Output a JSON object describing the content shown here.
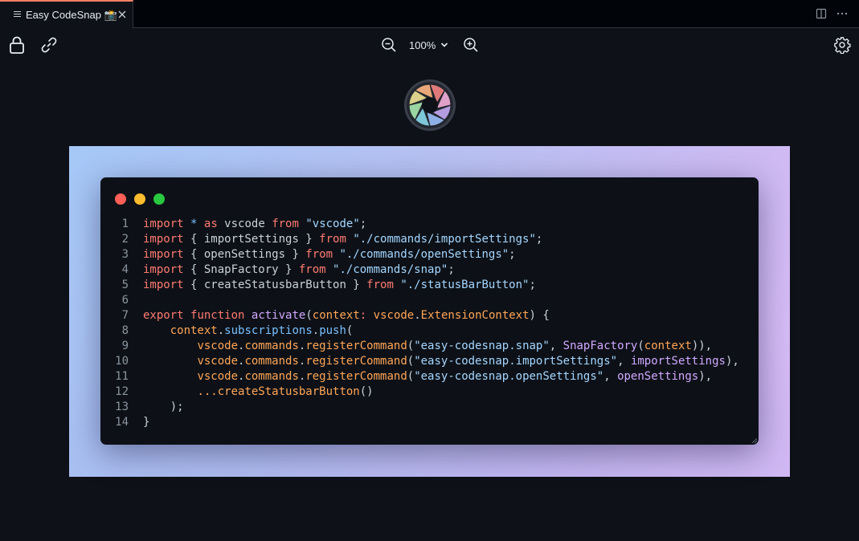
{
  "tab": {
    "title": "Easy CodeSnap 📸"
  },
  "toolbar": {
    "zoom": "100%"
  },
  "window_dots": [
    "#ff5f57",
    "#febc2e",
    "#28c840"
  ],
  "colors": {
    "keyword": "#ff7b72",
    "string": "#a5d6ff",
    "func": "#d2a8ff",
    "prop": "#79c0ff",
    "param": "#ffa657",
    "plain": "#c9d1d9",
    "line_number": "#8b949e"
  },
  "code": {
    "line_numbers": [
      "1",
      "2",
      "3",
      "4",
      "5",
      "6",
      "7",
      "8",
      "9",
      "10",
      "11",
      "12",
      "13",
      "14"
    ],
    "lines": [
      [
        [
          "k",
          "import"
        ],
        [
          "p",
          " "
        ],
        [
          "o",
          "*"
        ],
        [
          "p",
          " "
        ],
        [
          "k",
          "as"
        ],
        [
          "p",
          " vscode "
        ],
        [
          "k",
          "from"
        ],
        [
          "p",
          " "
        ],
        [
          "s",
          "\"vscode\""
        ],
        [
          "p",
          ";"
        ]
      ],
      [
        [
          "k",
          "import"
        ],
        [
          "p",
          " { importSettings } "
        ],
        [
          "k",
          "from"
        ],
        [
          "p",
          " "
        ],
        [
          "s",
          "\"./commands/importSettings\""
        ],
        [
          "p",
          ";"
        ]
      ],
      [
        [
          "k",
          "import"
        ],
        [
          "p",
          " { openSettings } "
        ],
        [
          "k",
          "from"
        ],
        [
          "p",
          " "
        ],
        [
          "s",
          "\"./commands/openSettings\""
        ],
        [
          "p",
          ";"
        ]
      ],
      [
        [
          "k",
          "import"
        ],
        [
          "p",
          " { SnapFactory } "
        ],
        [
          "k",
          "from"
        ],
        [
          "p",
          " "
        ],
        [
          "s",
          "\"./commands/snap\""
        ],
        [
          "p",
          ";"
        ]
      ],
      [
        [
          "k",
          "import"
        ],
        [
          "p",
          " { createStatusbarButton } "
        ],
        [
          "k",
          "from"
        ],
        [
          "p",
          " "
        ],
        [
          "s",
          "\"./statusBarButton\""
        ],
        [
          "p",
          ";"
        ]
      ],
      [],
      [
        [
          "k",
          "export"
        ],
        [
          "p",
          " "
        ],
        [
          "k",
          "function"
        ],
        [
          "p",
          " "
        ],
        [
          "f",
          "activate"
        ],
        [
          "p",
          "("
        ],
        [
          "a",
          "context"
        ],
        [
          "k",
          ":"
        ],
        [
          "p",
          " "
        ],
        [
          "a",
          "vscode"
        ],
        [
          "p",
          "."
        ],
        [
          "a",
          "ExtensionContext"
        ],
        [
          "p",
          ") {"
        ]
      ],
      [
        [
          "p",
          "    "
        ],
        [
          "a",
          "context"
        ],
        [
          "p",
          "."
        ],
        [
          "c",
          "subscriptions"
        ],
        [
          "p",
          "."
        ],
        [
          "c",
          "push"
        ],
        [
          "p",
          "("
        ]
      ],
      [
        [
          "p",
          "        "
        ],
        [
          "a",
          "vscode"
        ],
        [
          "p",
          "."
        ],
        [
          "a",
          "commands"
        ],
        [
          "p",
          "."
        ],
        [
          "a",
          "registerCommand"
        ],
        [
          "p",
          "("
        ],
        [
          "s",
          "\"easy-codesnap.snap\""
        ],
        [
          "p",
          ", "
        ],
        [
          "f",
          "SnapFactory"
        ],
        [
          "p",
          "("
        ],
        [
          "a",
          "context"
        ],
        [
          "p",
          ")),"
        ]
      ],
      [
        [
          "p",
          "        "
        ],
        [
          "a",
          "vscode"
        ],
        [
          "p",
          "."
        ],
        [
          "a",
          "commands"
        ],
        [
          "p",
          "."
        ],
        [
          "a",
          "registerCommand"
        ],
        [
          "p",
          "("
        ],
        [
          "s",
          "\"easy-codesnap.importSettings\""
        ],
        [
          "p",
          ", "
        ],
        [
          "f",
          "importSettings"
        ],
        [
          "p",
          "),"
        ]
      ],
      [
        [
          "p",
          "        "
        ],
        [
          "a",
          "vscode"
        ],
        [
          "p",
          "."
        ],
        [
          "a",
          "commands"
        ],
        [
          "p",
          "."
        ],
        [
          "a",
          "registerCommand"
        ],
        [
          "p",
          "("
        ],
        [
          "s",
          "\"easy-codesnap.openSettings\""
        ],
        [
          "p",
          ", "
        ],
        [
          "f",
          "openSettings"
        ],
        [
          "p",
          "),"
        ]
      ],
      [
        [
          "p",
          "        "
        ],
        [
          "a",
          "...createStatusbarButton"
        ],
        [
          "p",
          "()"
        ]
      ],
      [
        [
          "p",
          "    );"
        ]
      ],
      [
        [
          "p",
          "}"
        ]
      ]
    ]
  }
}
